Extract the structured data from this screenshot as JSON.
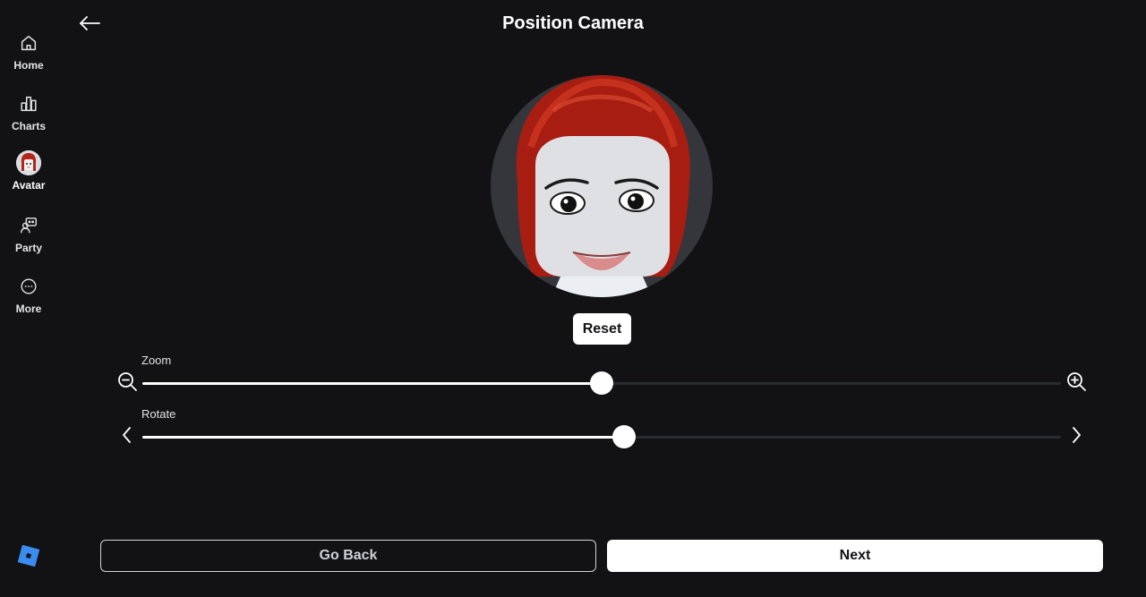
{
  "sidebar": {
    "items": [
      {
        "label": "Home",
        "icon": "home-icon"
      },
      {
        "label": "Charts",
        "icon": "charts-icon"
      },
      {
        "label": "Avatar",
        "icon": "avatar-icon"
      },
      {
        "label": "Party",
        "icon": "party-icon"
      },
      {
        "label": "More",
        "icon": "more-icon"
      }
    ],
    "active": "Avatar",
    "logo_icon": "roblox-logo-icon"
  },
  "header": {
    "title": "Position Camera",
    "back_icon": "arrow-left-icon"
  },
  "preview": {
    "reset_label": "Reset"
  },
  "controls": {
    "zoom": {
      "label": "Zoom",
      "value_percent": 50,
      "decrease_icon": "zoom-out-icon",
      "increase_icon": "zoom-in-icon"
    },
    "rotate": {
      "label": "Rotate",
      "value_percent": 52.4,
      "decrease_icon": "chevron-left-icon",
      "increase_icon": "chevron-right-icon"
    }
  },
  "footer": {
    "go_back_label": "Go Back",
    "next_label": "Next"
  },
  "colors": {
    "background": "#121215",
    "accent": "#ffffff",
    "track": "#2a2b30",
    "preview_bg": "#34363b",
    "logo": "#3b8cf0"
  }
}
